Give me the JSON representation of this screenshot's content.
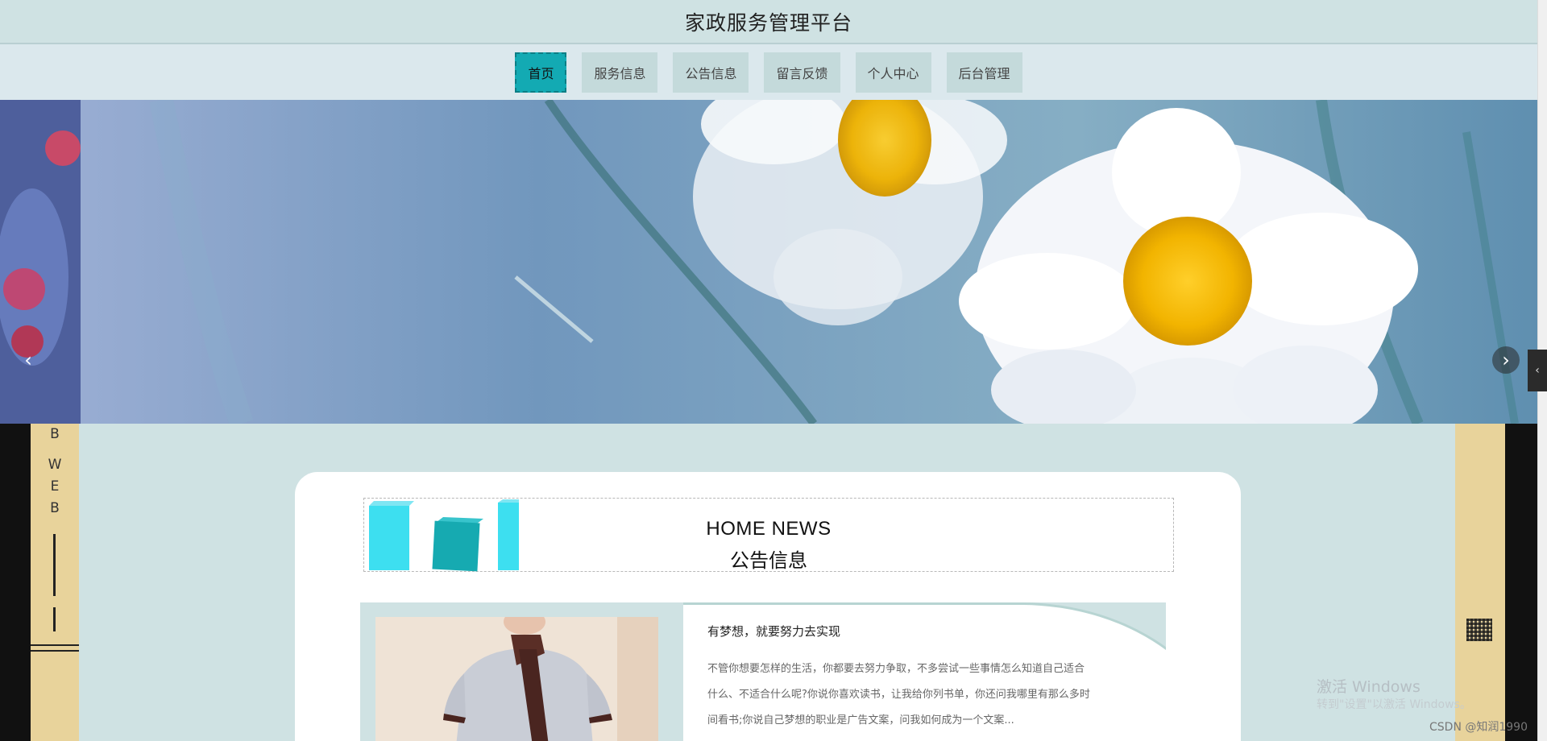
{
  "header": {
    "title": "家政服务管理平台"
  },
  "nav": {
    "items": [
      {
        "label": "首页",
        "active": true
      },
      {
        "label": "服务信息"
      },
      {
        "label": "公告信息"
      },
      {
        "label": "留言反馈"
      },
      {
        "label": "个人中心"
      },
      {
        "label": "后台管理"
      }
    ]
  },
  "banner": {
    "prev_icon": "chevron-left-icon",
    "next_icon": "chevron-right-icon"
  },
  "side": {
    "letters_top": "B",
    "letters": [
      "W",
      "E",
      "B"
    ]
  },
  "section": {
    "title_en": "HOME NEWS",
    "title_cn": "公告信息"
  },
  "news": {
    "title": "有梦想，就要努力去实现",
    "body": "不管你想要怎样的生活，你都要去努力争取，不多尝试一些事情怎么知道自己适合什么、不适合什么呢?你说你喜欢读书，让我给你列书单，你还问我哪里有那么多时间看书;你说自己梦想的职业是广告文案，问我如何成为一个文案..."
  },
  "watermark": {
    "line1": "激活 Windows",
    "line2": "转到\"设置\"以激活 Windows。"
  },
  "credit": "CSDN @知润1990",
  "colors": {
    "accent": "#13aab3",
    "nav_bg": "#c4dadb",
    "page_bg": "#cfe2e3",
    "strip": "#e8d39b"
  }
}
